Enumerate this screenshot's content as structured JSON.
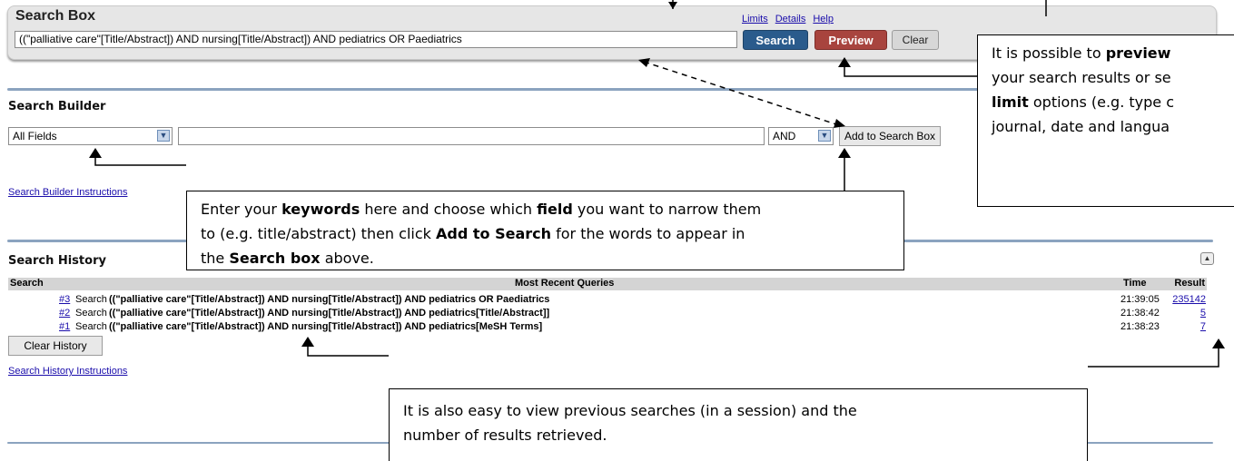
{
  "search_box": {
    "title": "Search Box",
    "links": [
      "Limits",
      "Details",
      "Help"
    ],
    "query": "((\"palliative care\"[Title/Abstract]) AND nursing[Title/Abstract]) AND pediatrics OR Paediatrics",
    "search_label": "Search",
    "preview_label": "Preview",
    "clear_label": "Clear"
  },
  "search_builder": {
    "title": "Search Builder",
    "field_value": "All Fields",
    "operator_value": "AND",
    "add_label": "Add to Search Box",
    "instructions_link": "Search Builder Instructions"
  },
  "search_history": {
    "title": "Search History",
    "columns": [
      "Search",
      "Most Recent Queries",
      "Time",
      "Result"
    ],
    "rows": [
      {
        "num": "#3",
        "label": "Search",
        "query": "((\"palliative care\"[Title/Abstract]) AND nursing[Title/Abstract]) AND pediatrics OR Paediatrics",
        "time": "21:39:05",
        "result": "235142"
      },
      {
        "num": "#2",
        "label": "Search",
        "query": "((\"palliative care\"[Title/Abstract]) AND nursing[Title/Abstract]) AND pediatrics[Title/Abstract]]",
        "time": "21:38:42",
        "result": "5"
      },
      {
        "num": "#1",
        "label": "Search",
        "query": "((\"palliative care\"[Title/Abstract]) AND nursing[Title/Abstract]) AND pediatrics[MeSH Terms]",
        "time": "21:38:23",
        "result": "7"
      }
    ],
    "clear_label": "Clear History",
    "instructions_link": "Search History Instructions"
  },
  "callouts": {
    "preview": {
      "l1a": "It is possible to ",
      "l1b": "preview",
      "l2": "your search results or se",
      "l3a": "limit",
      "l3b": " options (e.g. type c",
      "l4": "journal, date and langua"
    },
    "keywords": {
      "p1": "Enter your ",
      "b1": "keywords",
      "p2": " here and choose which ",
      "b2": "field",
      "p3": " you want to narrow them",
      "p4": "to (e.g. title/abstract) then click ",
      "b3": "Add to Search",
      "p5": " for the words to appear in",
      "p6": "the ",
      "b4": "Search box",
      "p7": " above."
    },
    "history": {
      "line1": "It is also easy to view previous searches (in a session) and the",
      "line2": "number of results retrieved."
    }
  }
}
